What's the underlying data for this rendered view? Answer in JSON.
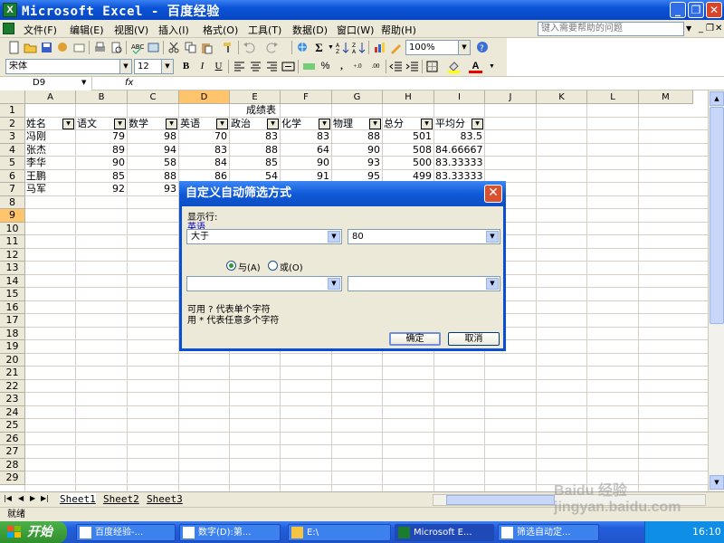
{
  "window": {
    "title": "Microsoft Excel - 百度经验",
    "help_placeholder": "键入需要帮助的问题"
  },
  "menu": [
    "文件(F)",
    "编辑(E)",
    "视图(V)",
    "插入(I)",
    "格式(O)",
    "工具(T)",
    "数据(D)",
    "窗口(W)",
    "帮助(H)"
  ],
  "toolbar": {
    "zoom": "100%",
    "font_name": "宋体",
    "font_size": "12",
    "bold": "B",
    "italic": "I",
    "underline": "U",
    "percent": "%",
    "comma": ",",
    "inc_decimal": "+.0",
    "dec_decimal": ".00",
    "sigma": "Σ",
    "font_color_letter": "A"
  },
  "formula_bar": {
    "name_box": "D9",
    "fx": "fx"
  },
  "sheet": {
    "columns": [
      "A",
      "B",
      "C",
      "D",
      "E",
      "F",
      "G",
      "H",
      "I",
      "J",
      "K",
      "L",
      "M"
    ],
    "selected_column": "D",
    "selected_row": 9,
    "title": "成绩表",
    "headers": [
      "姓名",
      "语文",
      "数学",
      "英语",
      "政治",
      "化学",
      "物理",
      "总分",
      "平均分"
    ],
    "rows": [
      [
        "冯刚",
        "79",
        "98",
        "70",
        "83",
        "83",
        "88",
        "501",
        "83.5"
      ],
      [
        "张杰",
        "89",
        "94",
        "83",
        "88",
        "64",
        "90",
        "508",
        "84.66667"
      ],
      [
        "李华",
        "90",
        "58",
        "84",
        "85",
        "90",
        "93",
        "500",
        "83.33333"
      ],
      [
        "王鹏",
        "85",
        "88",
        "86",
        "54",
        "91",
        "95",
        "499",
        "83.33333"
      ],
      [
        "马军",
        "92",
        "93",
        "",
        "",
        "",
        "",
        "",
        ""
      ]
    ],
    "row_numbers": [
      1,
      2,
      3,
      4,
      5,
      6,
      7,
      8,
      9,
      10,
      11,
      12,
      13,
      14,
      15,
      16,
      17,
      18,
      19,
      20,
      21,
      22,
      23,
      24,
      25,
      26,
      27,
      28,
      29
    ]
  },
  "sheet_tabs": [
    "Sheet1",
    "Sheet2",
    "Sheet3"
  ],
  "status": "就绪",
  "dialog": {
    "title": "自定义自动筛选方式",
    "show_rows_label": "显示行:",
    "field_name": "英语",
    "operator1": "大于",
    "value1": "80",
    "and_label": "与(A)",
    "or_label": "或(O)",
    "operator2": "",
    "value2": "",
    "hint1": "可用 ? 代表单个字符",
    "hint2": "用 * 代表任意多个字符",
    "ok": "确定",
    "cancel": "取消"
  },
  "taskbar": {
    "start": "开始",
    "tasks": [
      "百度经验-...",
      "数字(D):第...",
      "E:\\",
      "Microsoft E...",
      "筛选自动定..."
    ],
    "clock": "16:10"
  },
  "watermark": "Baidu 经验 jingyan.baidu.com",
  "colors": {
    "title_blue": "#0a53d6",
    "selected_header": "#ffc46c",
    "xp_green": "#2f8f2c"
  }
}
